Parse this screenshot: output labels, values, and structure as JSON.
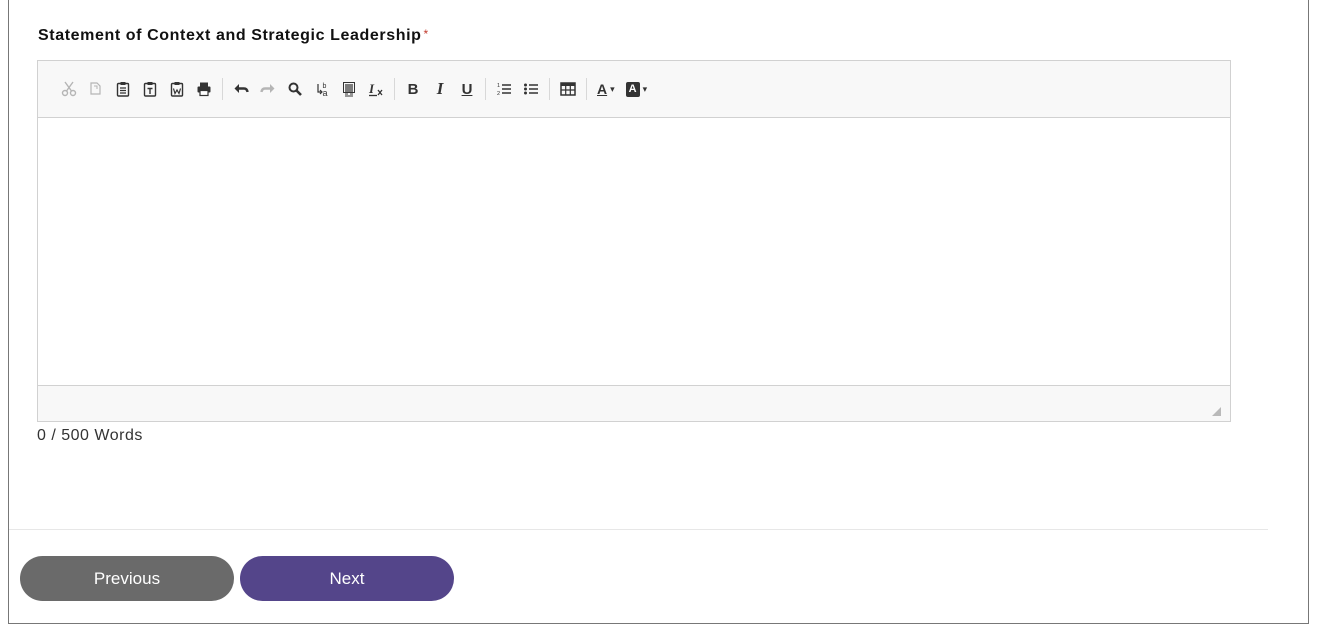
{
  "field": {
    "label": "Statement of Context and Strategic Leadership",
    "required_marker": "*",
    "content": ""
  },
  "toolbar": {
    "groups": [
      [
        "cut-icon",
        "copy-icon",
        "paste-icon",
        "paste-text-icon",
        "paste-word-icon",
        "print-icon"
      ],
      [
        "undo-icon",
        "redo-icon",
        "find-icon",
        "replace-icon",
        "select-all-icon",
        "remove-format-icon"
      ],
      [
        "bold-icon",
        "italic-icon",
        "underline-icon"
      ],
      [
        "numbered-list-icon",
        "bulleted-list-icon"
      ],
      [
        "table-icon"
      ],
      [
        "text-color-icon",
        "background-color-icon"
      ]
    ],
    "bold_glyph": "B",
    "italic_glyph": "I",
    "underline_glyph": "U",
    "text_color_glyph": "A",
    "bg_color_glyph": "A",
    "disabled": [
      "cut-icon",
      "copy-icon",
      "redo-icon"
    ]
  },
  "word_count": {
    "current": "0",
    "separator": " / ",
    "max": "500",
    "unit": " Words"
  },
  "buttons": {
    "previous": "Previous",
    "next": "Next"
  },
  "colors": {
    "previous_bg": "#6a6a6a",
    "next_bg": "#54458a",
    "required": "#c0392b"
  }
}
